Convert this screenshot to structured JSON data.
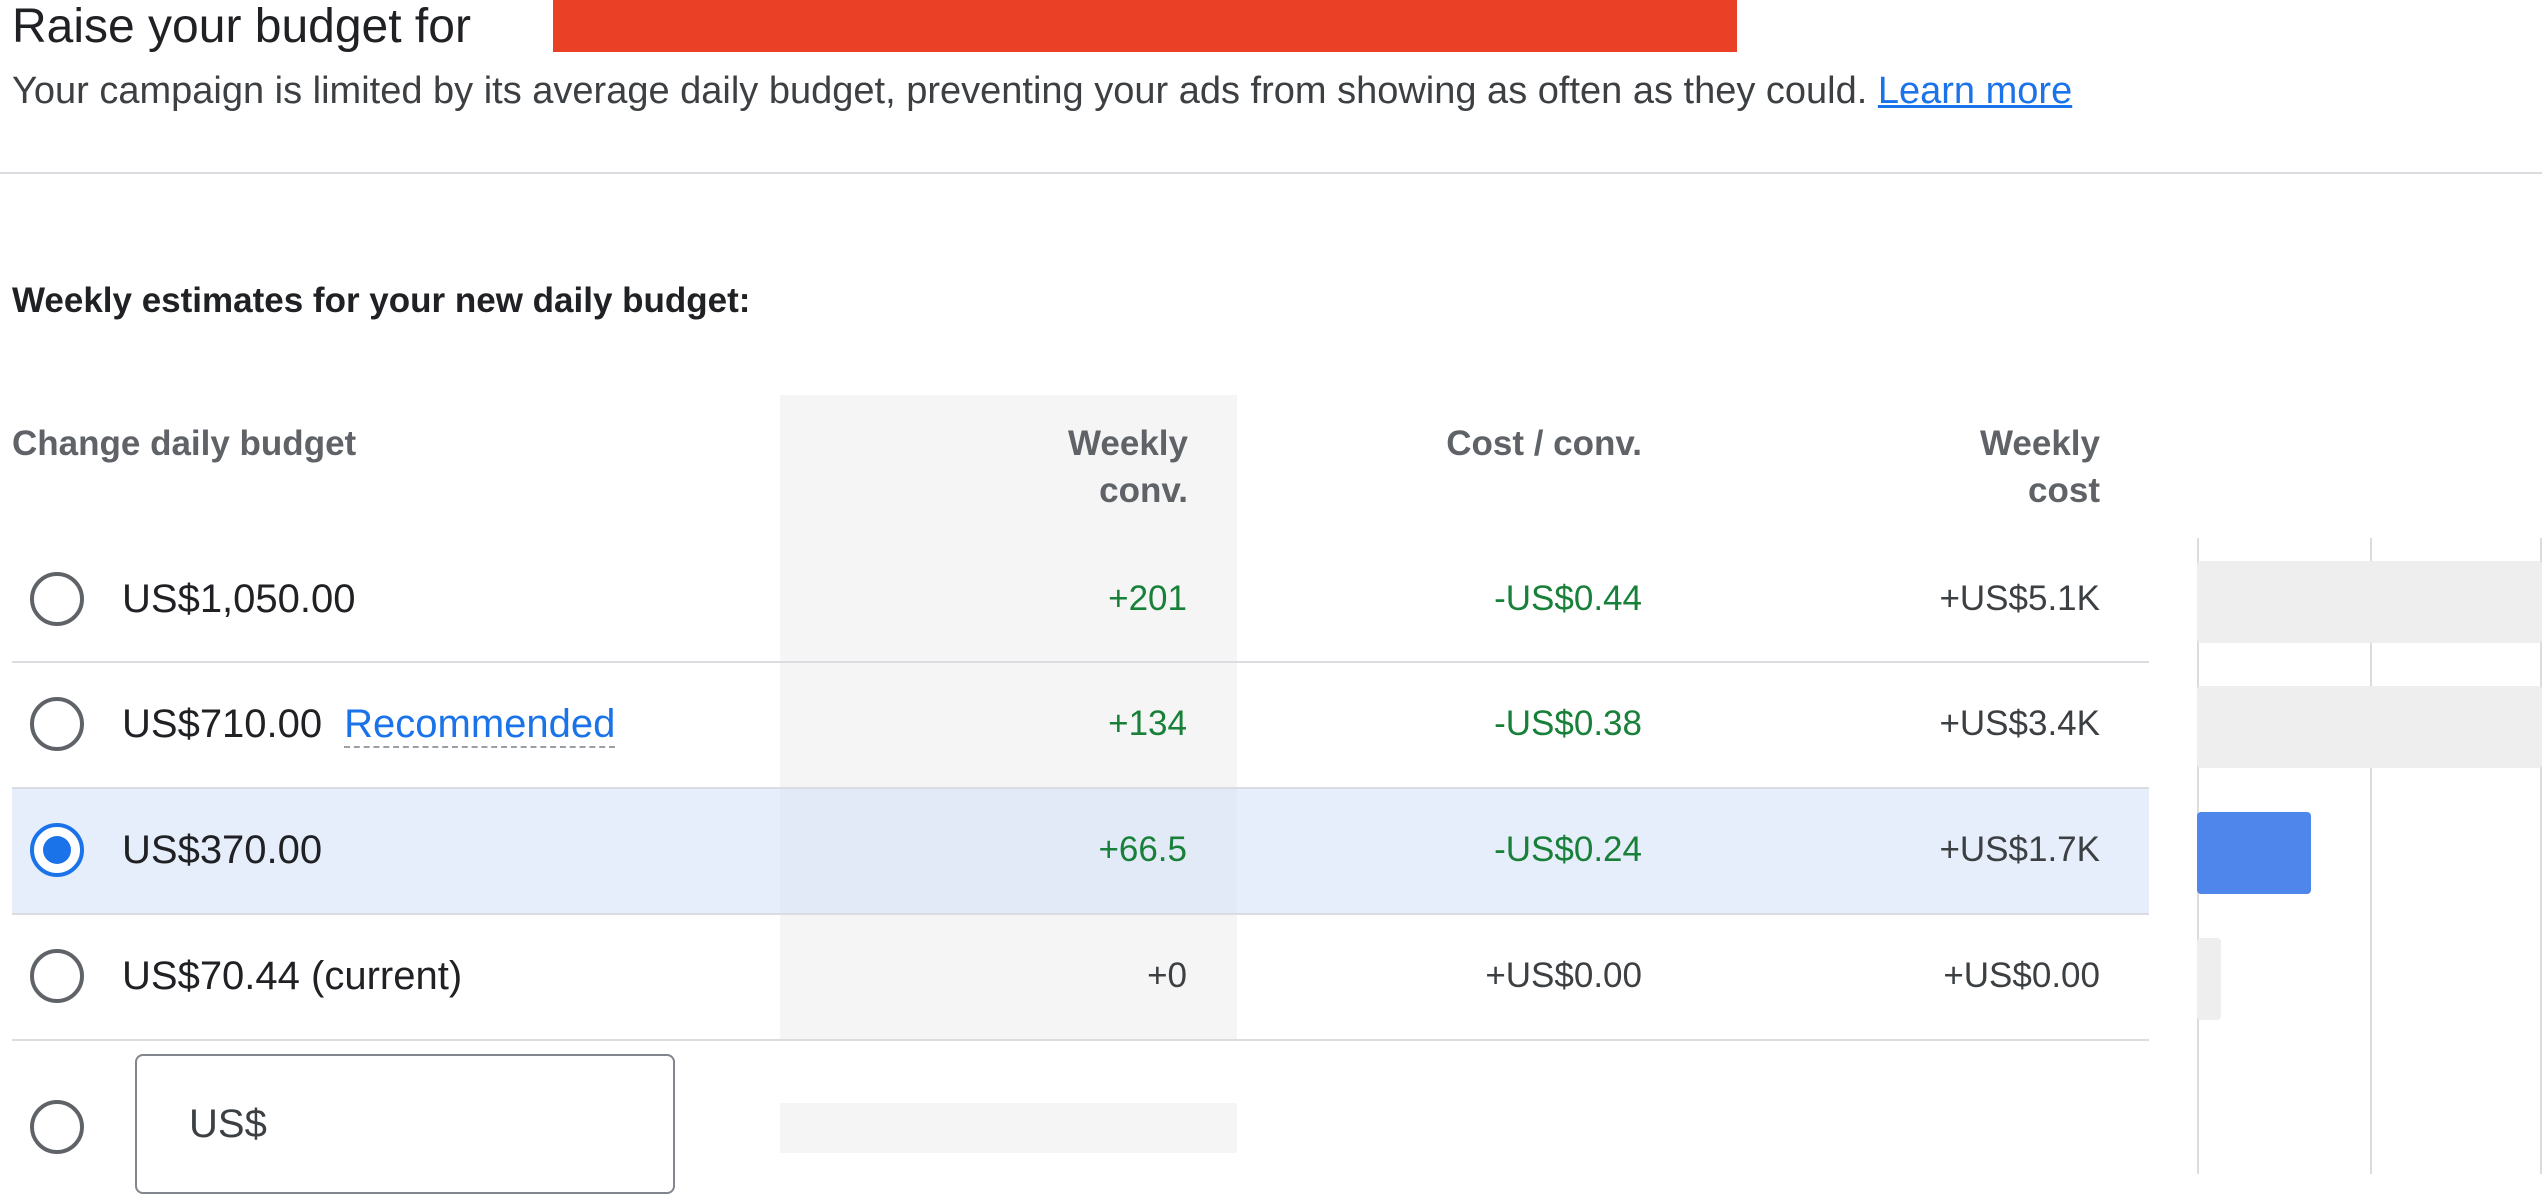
{
  "header": {
    "title": "Raise your budget for",
    "description": "Your campaign is limited by its average daily budget, preventing your ads from showing as often as they could.",
    "learn_more": "Learn more"
  },
  "section_heading": "Weekly estimates for your new daily budget:",
  "columns": {
    "change_budget": "Change daily budget",
    "weekly_conv": "Weekly conv.",
    "cost_per_conv": "Cost / conv.",
    "weekly_cost": "Weekly cost"
  },
  "rows": [
    {
      "budget": "US$1,050.00",
      "tag": "",
      "weekly_conv": "+201",
      "cost_per_conv": "-US$0.44",
      "weekly_cost": "+US$5.1K",
      "selected": false,
      "bar_fraction": 1.0
    },
    {
      "budget": "US$710.00",
      "tag": "Recommended",
      "weekly_conv": "+134",
      "cost_per_conv": "-US$0.38",
      "weekly_cost": "+US$3.4K",
      "selected": false,
      "bar_fraction": 1.0
    },
    {
      "budget": "US$370.00",
      "tag": "",
      "weekly_conv": "+66.5",
      "cost_per_conv": "-US$0.24",
      "weekly_cost": "+US$1.7K",
      "selected": true,
      "bar_fraction": 0.33
    },
    {
      "budget": "US$70.44 (current)",
      "tag": "",
      "weekly_conv": "+0",
      "cost_per_conv": "+US$0.00",
      "weekly_cost": "+US$0.00",
      "selected": false,
      "bar_fraction": 0.07
    }
  ],
  "custom_budget": {
    "prefix": "US$"
  },
  "colors": {
    "accent": "#1a73e8",
    "positive": "#188038",
    "redaction": "#ea4026",
    "bar_selected": "#4f86ec",
    "bar_unselected": "#eeeeee"
  }
}
